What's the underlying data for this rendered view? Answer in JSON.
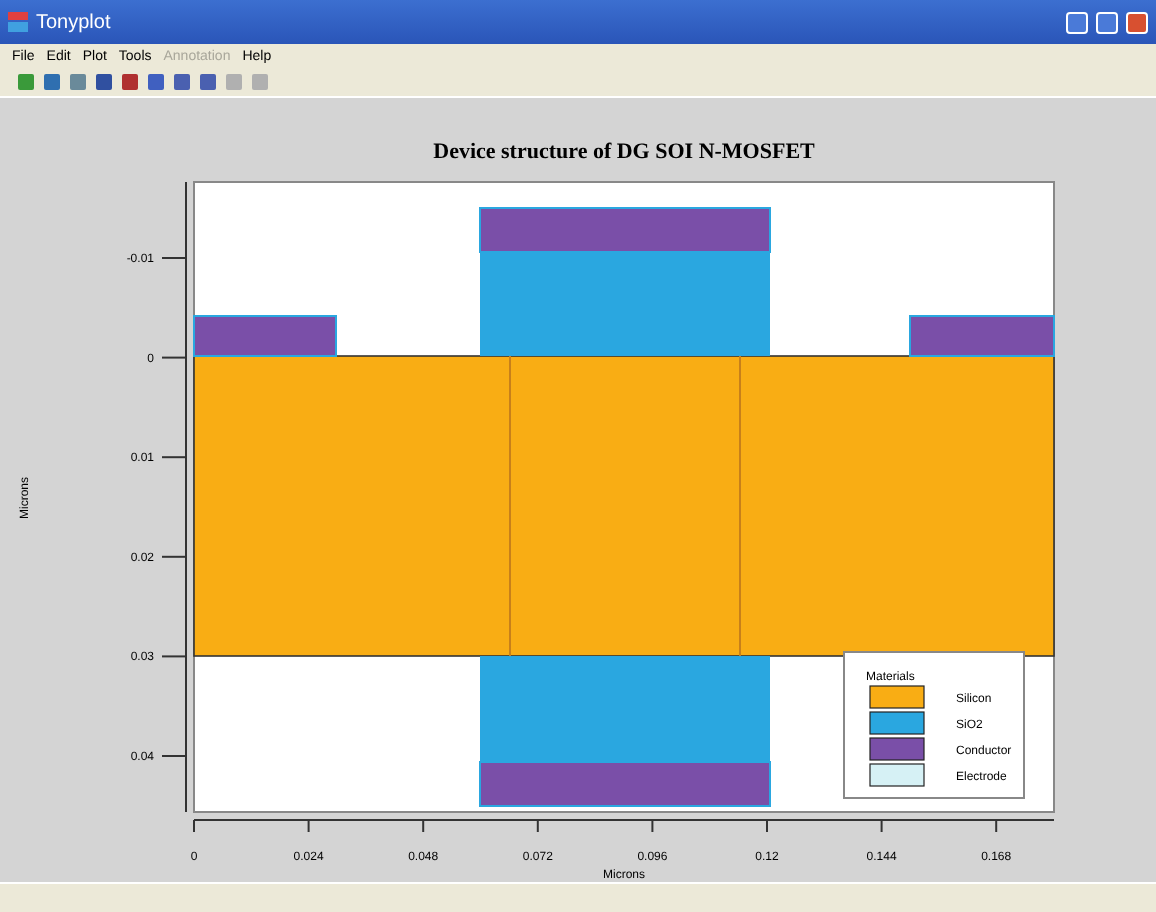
{
  "window": {
    "title": "Tonyplot"
  },
  "menu": [
    {
      "label": "File",
      "disabled": false
    },
    {
      "label": "Edit",
      "disabled": false
    },
    {
      "label": "Plot",
      "disabled": false
    },
    {
      "label": "Tools",
      "disabled": false
    },
    {
      "label": "Annotation",
      "disabled": true
    },
    {
      "label": "Help",
      "disabled": false
    }
  ],
  "plot": {
    "title": "Device structure of DG SOI N-MOSFET",
    "xlabel": "Microns",
    "ylabel": "Microns",
    "xticks": [
      "0",
      "0.024",
      "0.048",
      "0.072",
      "0.096",
      "0.12",
      "0.144",
      "0.168"
    ],
    "yticks": [
      "-0.01",
      "0",
      "0.01",
      "0.02",
      "0.03",
      "0.04"
    ],
    "legend": {
      "title": "Materials",
      "items": [
        {
          "label": "Silicon",
          "color": "#f9ad14"
        },
        {
          "label": "SiO2",
          "color": "#2aa7e0"
        },
        {
          "label": "Conductor",
          "color": "#7a4fa8"
        },
        {
          "label": "Electrode",
          "color": "#d6f1f5"
        }
      ]
    }
  }
}
